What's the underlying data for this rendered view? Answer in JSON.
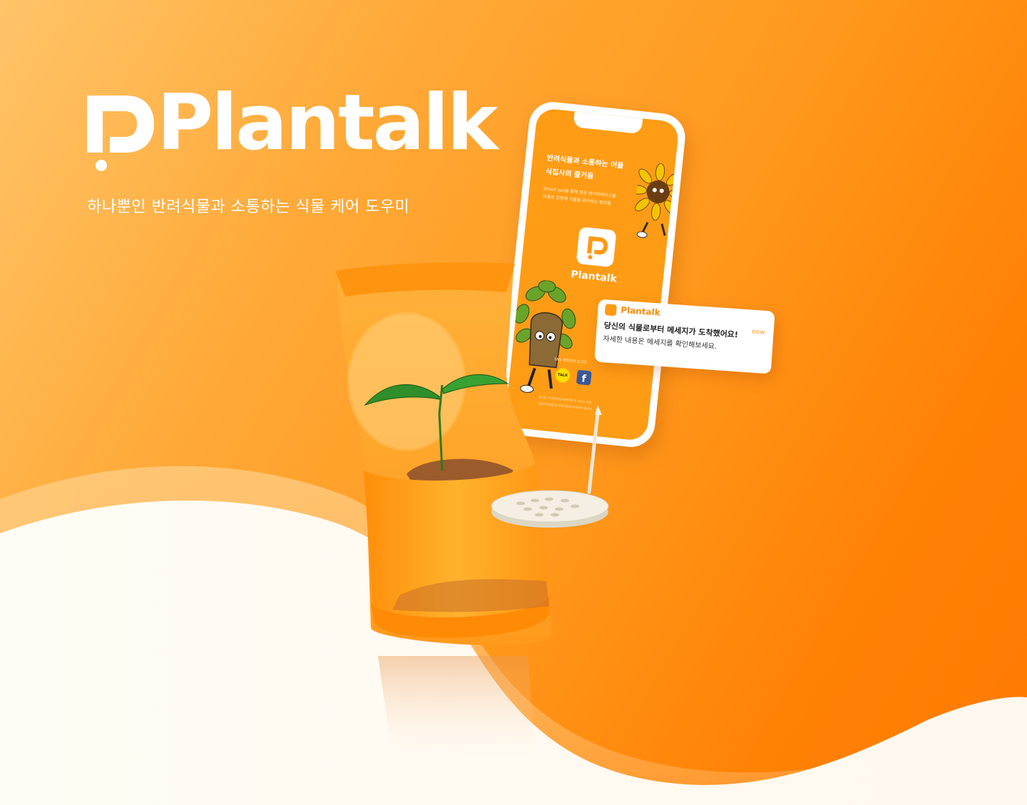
{
  "brand": {
    "name": "Plantalk",
    "tagline": "하나뿐인 반려식물과 소통하는 식물 케어 도우미"
  },
  "phone": {
    "heading_line1": "반려식물과 소통하는 어플",
    "heading_line2": "식집사의 즐거움",
    "desc_line1": "Smart pot을 통해 얻은 데이터베이스를",
    "desc_line2": "이용로 간편해 식물을 관리하는 편리함",
    "app_name": "Plantalk",
    "login_label": "SNS 계정으로 로그인",
    "kakao_label": "TALK",
    "facebook_label": "f",
    "footer_line1": "로그인 시 회원가입 이용약관 및 서비스 개인",
    "footer_line2": "정보처리방침 및 이용약관에 동의하게 됩니다."
  },
  "notification": {
    "app_name": "Plantalk",
    "time": "now",
    "title": "당신의 식물로부터 메세지가 도착했어요!",
    "body": "자세한 내용은 메세지를 확인해보세요."
  },
  "colors": {
    "brand_orange": "#ff8a00",
    "light_orange": "#ffb347",
    "cream": "#fffaf2"
  }
}
